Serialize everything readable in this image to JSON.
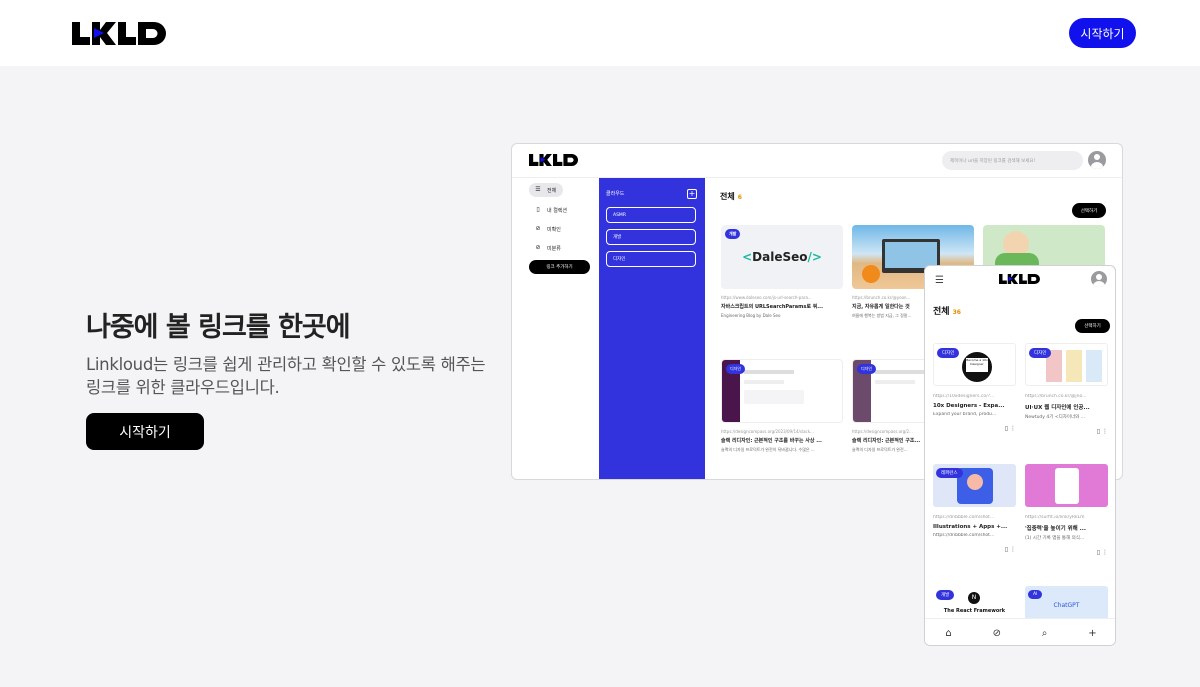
{
  "header": {
    "logo_text": "LKLD",
    "start_button": "시작하기"
  },
  "hero": {
    "title": "나중에 볼 링크를 한곳에",
    "description": "Linkloud는 링크를 쉽게 관리하고 확인할 수 있도록 해주는 링크를 위한 클라우드입니다.",
    "cta": "시작하기"
  },
  "desktop": {
    "search_placeholder": "제목이나 url을 저장된 링크를 검색해 보세요!",
    "nav": [
      {
        "label": "전체",
        "icon": "list-icon"
      },
      {
        "label": "내 컬렉션",
        "icon": "collection-icon"
      },
      {
        "label": "미확인",
        "icon": "eye-off-icon"
      },
      {
        "label": "미분류",
        "icon": "unsorted-icon"
      }
    ],
    "add_link": "링크 추가하기",
    "panel": {
      "title": "클라우드",
      "folders": [
        "ASMR",
        "개발",
        "디자인"
      ]
    },
    "main": {
      "title": "전체",
      "count": "6",
      "select_button": "선택하기"
    },
    "cards": [
      {
        "tag": "개발",
        "thumb_text": "DaleSeo",
        "url": "https://www.daleseo.com/js-url-search-para...",
        "title": "자바스크립트의 URLSearchParams로 쿼...",
        "sub": "Engineering Blog by Dale Seo"
      },
      {
        "tag": "",
        "url": "https://brunch.co.kr/@yoon...",
        "title": "지금, 자유롭게 일한다는 것",
        "sub": "여름에 행복는 방법 지금, 그 정말..."
      },
      {
        "tag": "",
        "url": "",
        "title": "",
        "sub": ""
      },
      {
        "tag": "디자인",
        "url": "https://designcompass.org/2023/09/14/slack...",
        "title": "슬랙 리디자인: 근본적인 구조를 바꾸는 사상 ...",
        "sub": "슬랙의 디자일 프로덕트가 완전히 뒤바뀝니다. 수많은 ..."
      },
      {
        "tag": "디자인",
        "url": "https://designcompass.org/2...",
        "title": "슬랙 리디자인: 근본적인 구조...",
        "sub": "슬랙의 디자일 프로덕트가 완전..."
      }
    ]
  },
  "mobile": {
    "title": "전체",
    "count": "36",
    "select_button": "선택하기",
    "cards": [
      {
        "tag": "디자인",
        "url": "https://10xdesigners.co/?...",
        "title": "10x Designers - Expa...",
        "sub": "Expand your brand, produ..."
      },
      {
        "tag": "디자인",
        "url": "https://brunch.co.kr/@jno...",
        "title": "UI·UX 웹 디자인에 인공...",
        "sub": "Newtudy 4기 <디자이너와 ..."
      },
      {
        "tag": "레퍼런스",
        "url": "https://dribbble.com/shot...",
        "title": "Illustrations + Apps +...",
        "sub": "https://dribbble.com/shot..."
      },
      {
        "tag": "",
        "url": "https://surfit.io/link/yRkLm",
        "title": "'집중력'을 높이기 위해 ...",
        "sub": "(1) 시간 기록 앱을 통해 의식..."
      },
      {
        "tag": "개발",
        "thumb_text": "The React Framework",
        "url": "",
        "title": "",
        "sub": ""
      },
      {
        "tag": "AI",
        "thumb_text": "ChatGPT",
        "url": "",
        "title": "",
        "sub": ""
      }
    ],
    "bottom_nav": [
      "home-icon",
      "eye-off-icon",
      "search-icon",
      "plus-icon"
    ]
  },
  "colors": {
    "brand_blue": "#1111ee",
    "panel_blue": "#3333dd",
    "black": "#000000"
  }
}
